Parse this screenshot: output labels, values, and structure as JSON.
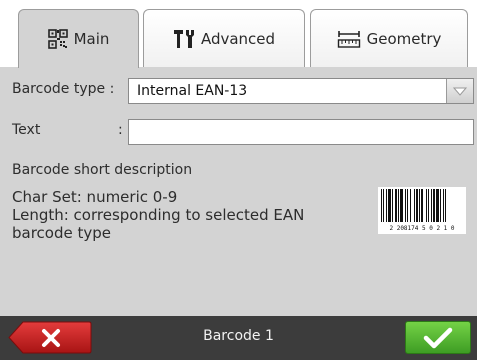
{
  "tabs": [
    {
      "label": "Main",
      "icon": "qr-code-icon",
      "active": true
    },
    {
      "label": "Advanced",
      "icon": "tools-icon",
      "active": false
    },
    {
      "label": "Geometry",
      "icon": "ruler-icon",
      "active": false
    }
  ],
  "form": {
    "barcode_type_label": "Barcode type :",
    "barcode_type_value": "Internal EAN-13",
    "text_label": "Text",
    "text_colon": ":",
    "text_value": ""
  },
  "description": {
    "title": "Barcode short description",
    "lines": [
      "Char Set: numeric 0-9",
      "Length: corresponding to selected EAN",
      "barcode type"
    ],
    "barcode_digits": "2  208174  5 0 2 1 0"
  },
  "footer": {
    "title": "Barcode 1",
    "cancel_icon": "close-icon",
    "confirm_icon": "check-icon"
  },
  "colors": {
    "panel_bg": "#d3d3d3",
    "cancel_red": "#c91e1e",
    "confirm_green": "#4eb12d",
    "footer_bg": "#3c3c3c"
  }
}
